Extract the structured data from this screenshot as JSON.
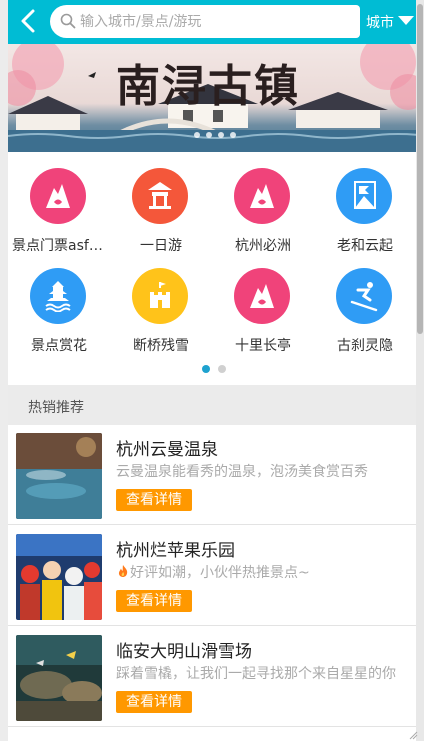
{
  "header": {
    "search_placeholder": "输入城市/景点/游玩",
    "city_label": "城市",
    "accent_color": "#00bcd4"
  },
  "banner": {
    "title": "南浔古镇",
    "page_count": 4
  },
  "categories": {
    "items": [
      {
        "label": "景点门票asfasdf",
        "icon": "mountain-icon",
        "color": "#f0437a"
      },
      {
        "label": "一日游",
        "icon": "pavilion-icon",
        "color": "#f4573a"
      },
      {
        "label": "杭州必洲",
        "icon": "mountain-icon",
        "color": "#f0437a"
      },
      {
        "label": "老和云起",
        "icon": "flag-mountain-icon",
        "color": "#2f9cf5"
      },
      {
        "label": "景点赏花",
        "icon": "pagoda-icon",
        "color": "#2f9cf5"
      },
      {
        "label": "断桥残雪",
        "icon": "castle-icon",
        "color": "#ffc31a"
      },
      {
        "label": "十里长亭",
        "icon": "mountain-icon",
        "color": "#f0437a"
      },
      {
        "label": "古刹灵隐",
        "icon": "skiing-icon",
        "color": "#2f9cf5"
      }
    ],
    "pager_count": 2,
    "pager_active": 1
  },
  "section": {
    "title": "热销推荐"
  },
  "recommendations": [
    {
      "title": "杭州云曼温泉",
      "desc": "云曼温泉能看秀的温泉，泡汤美食赏百秀",
      "button": "查看详情",
      "image": "hot-spring-photo"
    },
    {
      "title": "杭州烂苹果乐园",
      "desc": "好评如潮，小伙伴热推景点~",
      "desc_icon": "fire-icon",
      "button": "查看详情",
      "image": "theme-park-photo"
    },
    {
      "title": "临安大明山滑雪场",
      "desc": "踩着雪橇，让我们一起寻找那个来自星星的你",
      "button": "查看详情",
      "image": "aquarium-photo"
    }
  ]
}
